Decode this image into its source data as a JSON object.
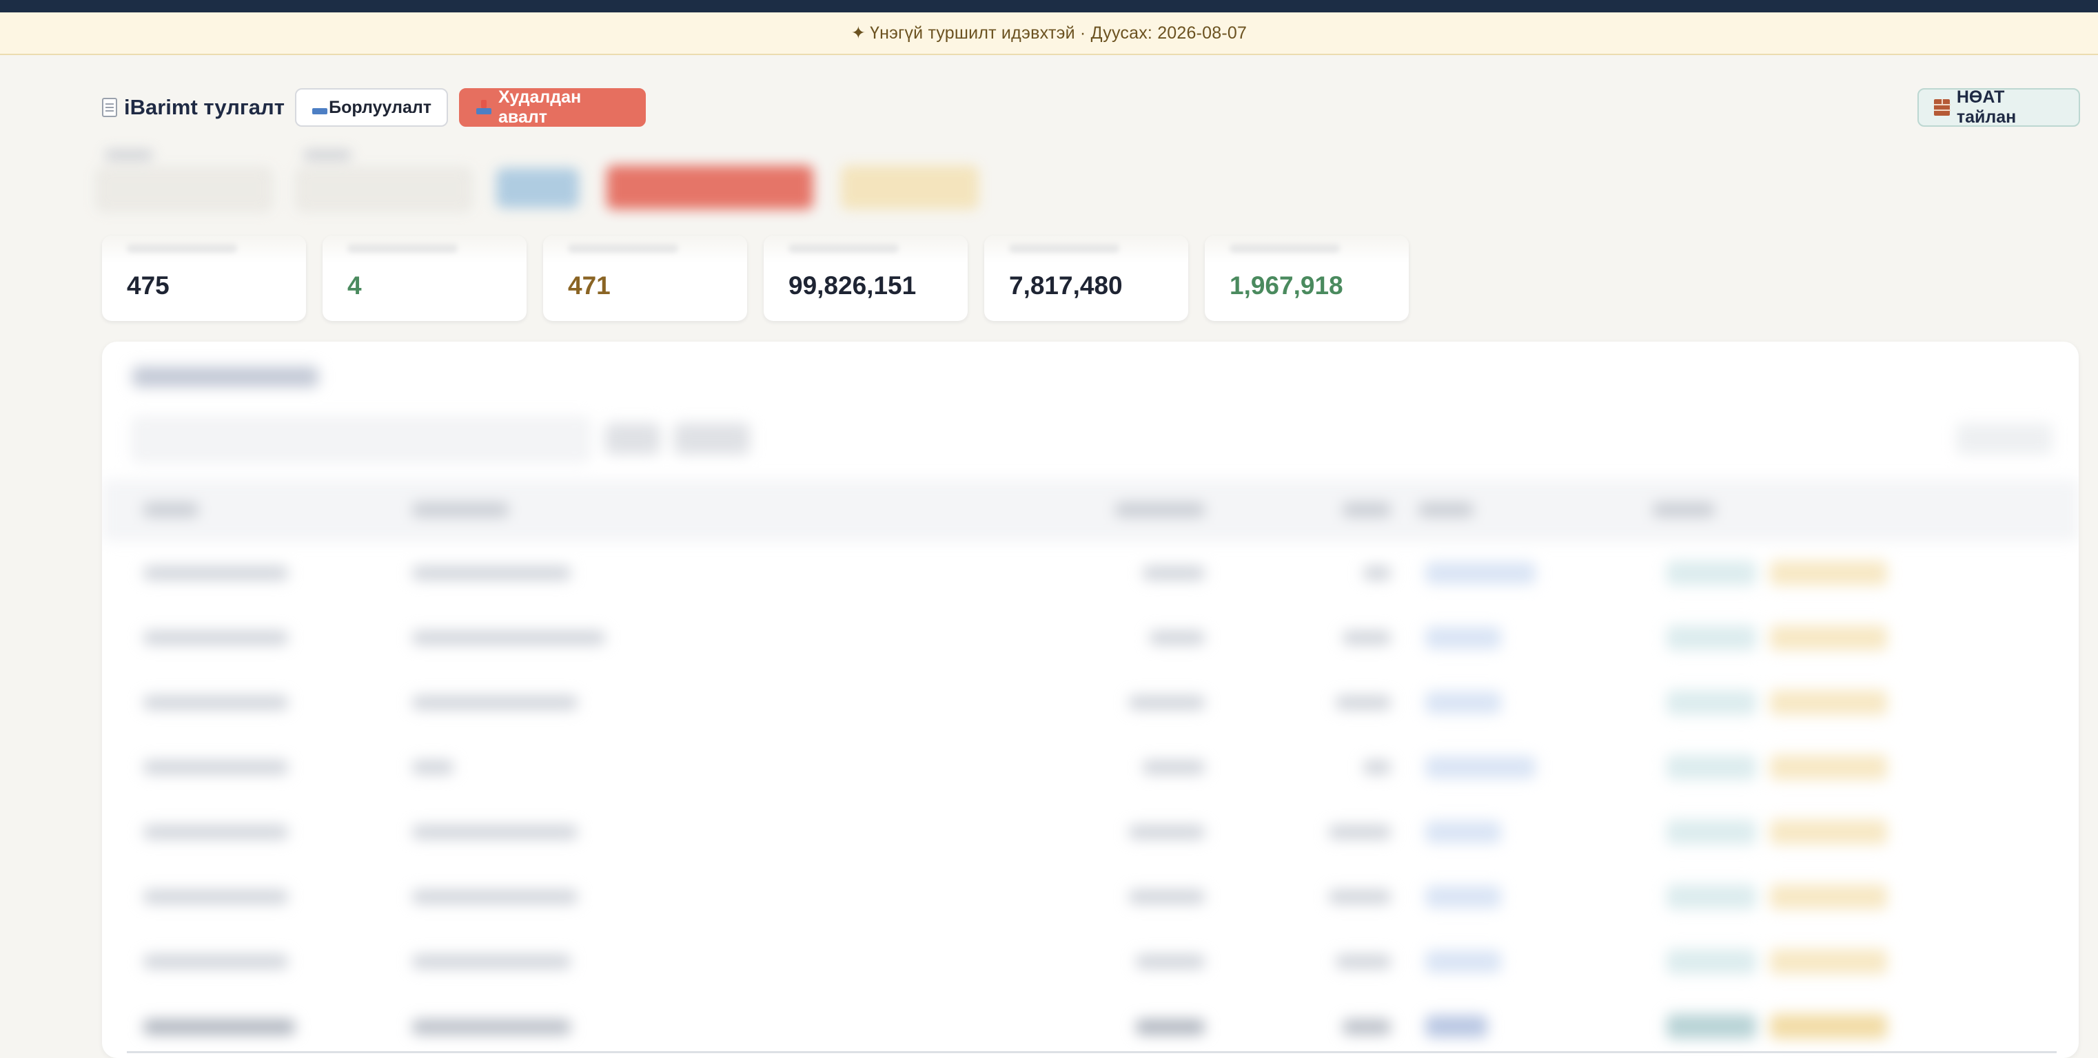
{
  "banner": {
    "icon": "sparkle-icon",
    "text": "Үнэгүй туршилт идэвхтэй · Дуусах: 2026-08-07"
  },
  "header": {
    "app_title": "iBarimt тулгалт",
    "nav": {
      "sales_label": "Борлуулалт",
      "purchase_label": "Худалдан авалт",
      "active": "purchase"
    },
    "vat_report_label": "НӨАТ тайлан",
    "icons": {
      "brand": "receipt-icon",
      "sales": "outbox-tray-icon",
      "purchase": "inbox-tray-icon",
      "vat_report": "brick-icon"
    }
  },
  "stats": [
    {
      "value": "475",
      "color": "#1e2433"
    },
    {
      "value": "4",
      "color": "#4a8a5e"
    },
    {
      "value": "471",
      "color": "#8a6424"
    },
    {
      "value": "99,826,151",
      "color": "#1e2433"
    },
    {
      "value": "7,817,480",
      "color": "#1e2433"
    },
    {
      "value": "1,967,918",
      "color": "#4a8a5e"
    }
  ],
  "colors": {
    "accent_purchase": "#e66f5f",
    "banner_bg": "#fdf6e3",
    "top_stripe": "#1c2d45",
    "page_bg": "#f6f5f1"
  },
  "table": {
    "visible_row_count": 8,
    "content_state": "blurred"
  }
}
